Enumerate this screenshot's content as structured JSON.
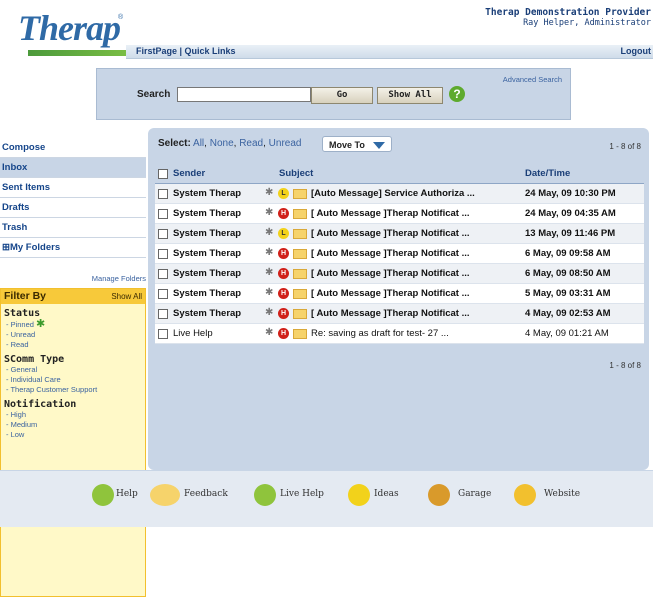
{
  "header": {
    "logo_text": "Therap",
    "logo_reg": "®",
    "provider": "Therap Demonstration Provider",
    "user": "Ray Helper, Administrator",
    "nav_links": "FirstPage | Quick Links",
    "logout": "Logout"
  },
  "search": {
    "label": "Search",
    "value": "",
    "advanced": "Advanced Search",
    "go": "Go",
    "show_all": "Show All",
    "help_glyph": "?"
  },
  "sidebar": {
    "items": [
      {
        "label": "Compose"
      },
      {
        "label": "Inbox"
      },
      {
        "label": "Sent Items"
      },
      {
        "label": "Drafts"
      },
      {
        "label": "Trash"
      },
      {
        "label": "⊞My Folders"
      }
    ],
    "manage_folders": "Manage Folders"
  },
  "filter": {
    "title": "Filter By",
    "show_all": "Show All",
    "status": {
      "title": "Status",
      "items": [
        "- Pinned",
        "- Unread",
        "- Read"
      ]
    },
    "scomm": {
      "title": "SComm Type",
      "items": [
        "- General",
        "- Individual Care",
        "- Therap Customer Support"
      ]
    },
    "notification": {
      "title": "Notification",
      "items": [
        "- High",
        "- Medium",
        "- Low"
      ]
    }
  },
  "toolbar": {
    "select_label": "Select:",
    "all": "All",
    "none": "None",
    "read": "Read",
    "unread": "Unread",
    "move_to": "Move To",
    "count_top": "1 - 8 of 8",
    "count_bottom": "1 - 8 of 8"
  },
  "table": {
    "headers": {
      "sender": "Sender",
      "subject": "Subject",
      "date": "Date/Time"
    },
    "rows": [
      {
        "sender": "System Therap",
        "priority": "L",
        "subject": "[Auto Message] Service Authoriza ...",
        "date": "24 May, 09 10:30 PM"
      },
      {
        "sender": "System Therap",
        "priority": "H",
        "subject": "[ Auto Message ]Therap Notificat ...",
        "date": "24 May, 09 04:35 AM"
      },
      {
        "sender": "System Therap",
        "priority": "L",
        "subject": "[ Auto Message ]Therap Notificat ...",
        "date": "13 May, 09 11:46 PM"
      },
      {
        "sender": "System Therap",
        "priority": "H",
        "subject": "[ Auto Message ]Therap Notificat ...",
        "date": "6 May, 09 09:58 AM"
      },
      {
        "sender": "System Therap",
        "priority": "H",
        "subject": "[ Auto Message ]Therap Notificat ...",
        "date": "6 May, 09 08:50 AM"
      },
      {
        "sender": "System Therap",
        "priority": "H",
        "subject": "[ Auto Message ]Therap Notificat ...",
        "date": "5 May, 09 03:31 AM"
      },
      {
        "sender": "System Therap",
        "priority": "H",
        "subject": "[ Auto Message ]Therap Notificat ...",
        "date": "4 May, 09 02:53 AM"
      },
      {
        "sender": "Live Help",
        "priority": "H",
        "subject": "Re: saving as draft for test- 27 ...",
        "date": "4 May, 09 01:21 AM"
      }
    ]
  },
  "footer": {
    "help": "Help",
    "feedback": "Feedback",
    "live_help": "Live Help",
    "ideas": "Ideas",
    "garage": "Garage",
    "website": "Website"
  },
  "colors": {
    "accent": "#2f6aa6",
    "panel": "#c8d5e6",
    "filter_bg": "#fff9c8",
    "filter_head": "#f7c93a",
    "high": "#d0211a",
    "low": "#f2d21b"
  }
}
